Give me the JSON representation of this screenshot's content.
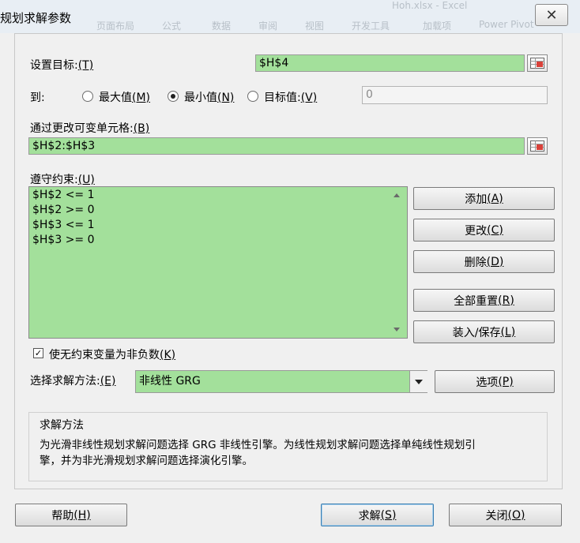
{
  "window": {
    "title": "规划求解参数",
    "close_glyph": "✕",
    "ribbon_ghost": [
      "页面布局",
      "公式",
      "数据",
      "审阅",
      "视图",
      "开发工具",
      "加载项",
      "Power Pivot"
    ],
    "file_ghost": "Hoh.xlsx - Excel"
  },
  "objective": {
    "label": "设置目标:",
    "hotkey": "(T)",
    "value": "$H$4"
  },
  "to": {
    "label": "到:",
    "options": [
      {
        "label": "最大值",
        "hotkey": "(M)",
        "checked": false
      },
      {
        "label": "最小值",
        "hotkey": "(N)",
        "checked": true
      },
      {
        "label": "目标值:",
        "hotkey": "(V)",
        "checked": false
      }
    ],
    "target_value": "0"
  },
  "variables": {
    "label": "通过更改可变单元格:",
    "hotkey": "(B)",
    "value": "$H$2:$H$3"
  },
  "constraints": {
    "label": "遵守约束:",
    "hotkey": "(U)",
    "items": [
      "$H$2 <= 1",
      "$H$2 >= 0",
      "$H$3 <= 1",
      "$H$3 >= 0"
    ]
  },
  "side_buttons": {
    "add": {
      "label": "添加",
      "hotkey": "(A)"
    },
    "change": {
      "label": "更改",
      "hotkey": "(C)"
    },
    "delete": {
      "label": "删除",
      "hotkey": "(D)"
    },
    "reset_all": {
      "label": "全部重置",
      "hotkey": "(R)"
    },
    "load_save": {
      "label": "装入/保存",
      "hotkey": "(L)"
    }
  },
  "nonneg": {
    "checked": true,
    "label": "使无约束变量为非负数",
    "hotkey": "(K)"
  },
  "method": {
    "label": "选择求解方法:",
    "hotkey": "(E)",
    "selected": "非线性 GRG",
    "options_button": {
      "label": "选项",
      "hotkey": "(P)"
    }
  },
  "solving_method": {
    "heading": "求解方法",
    "line1": "为光滑非线性规划求解问题选择 GRG 非线性引擎。为线性规划求解问题选择单纯线性规划引",
    "line2": "擎，并为非光滑规划求解问题选择演化引擎。"
  },
  "footer": {
    "help": {
      "label": "帮助",
      "hotkey": "(H)"
    },
    "solve": {
      "label": "求解",
      "hotkey": "(S)"
    },
    "close": {
      "label": "关闭",
      "hotkey": "(O)"
    }
  },
  "colors": {
    "field_green": "#a3e09b",
    "dialog_bg": "#f0f0f0"
  }
}
